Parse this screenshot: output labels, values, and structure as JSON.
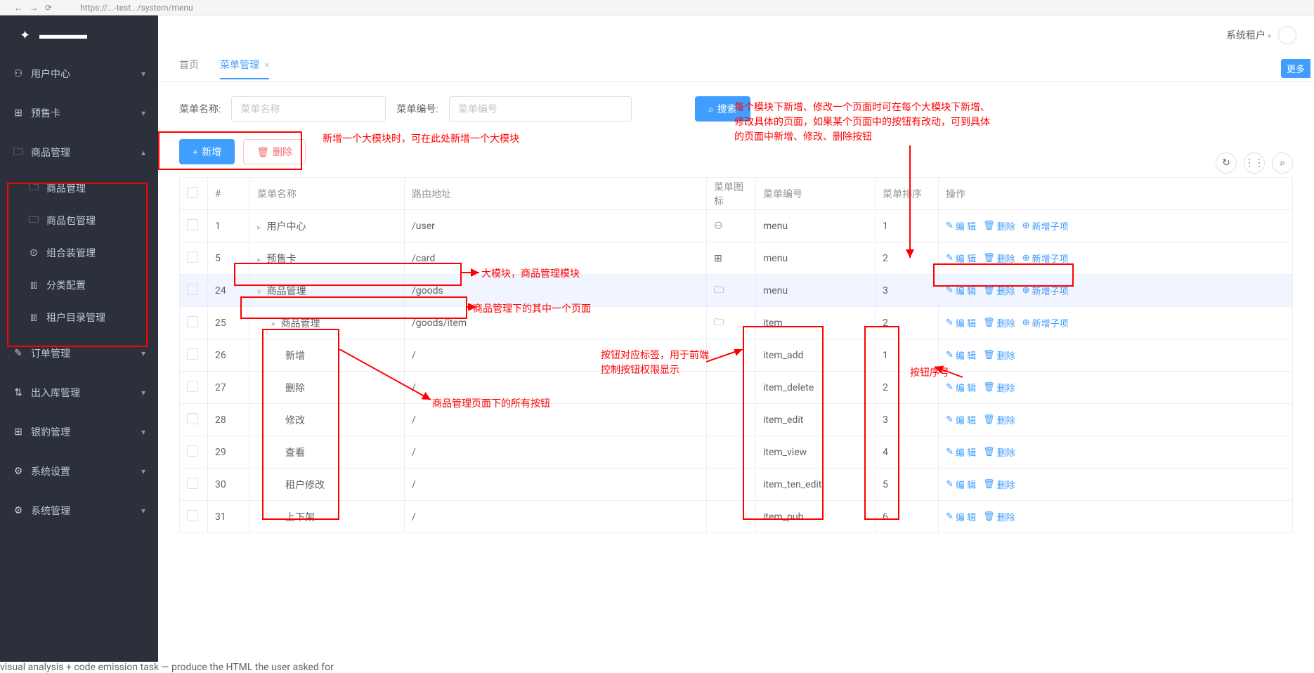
{
  "browser": {
    "url": "https://...-test.../system/menu"
  },
  "header": {
    "tenant": "系统租户"
  },
  "sidebar": {
    "items": [
      {
        "icon": "user-icon",
        "glyph": "⚇",
        "label": "用户中心",
        "chev": "▾"
      },
      {
        "icon": "card-icon",
        "glyph": "⊞",
        "label": "预售卡",
        "chev": "▾"
      },
      {
        "icon": "folder-icon",
        "glyph": "🗀",
        "label": "商品管理",
        "chev": "▴",
        "open": true,
        "children": [
          {
            "icon": "folder-icon",
            "glyph": "🗀",
            "label": "商品管理"
          },
          {
            "icon": "folder-icon",
            "glyph": "🗀",
            "label": "商品包管理"
          },
          {
            "icon": "combo-icon",
            "glyph": "⊙",
            "label": "组合装管理"
          },
          {
            "icon": "chart-icon",
            "glyph": "⫾⫾",
            "label": "分类配置"
          },
          {
            "icon": "chart-icon",
            "glyph": "⫾⫾",
            "label": "租户目录管理"
          }
        ]
      },
      {
        "icon": "order-icon",
        "glyph": "✎",
        "label": "订单管理",
        "chev": "▾"
      },
      {
        "icon": "stock-icon",
        "glyph": "⇅",
        "label": "出入库管理",
        "chev": "▾"
      },
      {
        "icon": "pos-icon",
        "glyph": "⊞",
        "label": "银豹管理",
        "chev": "▾"
      },
      {
        "icon": "gear-icon",
        "glyph": "⚙",
        "label": "系统设置",
        "chev": "▾"
      },
      {
        "icon": "gear-icon",
        "glyph": "⚙",
        "label": "系统管理",
        "chev": "▾"
      }
    ]
  },
  "tabs": {
    "home": "首页",
    "current": "菜单管理",
    "more": "更多"
  },
  "search": {
    "name_label": "菜单名称:",
    "name_ph": "菜单名称",
    "code_label": "菜单编号:",
    "code_ph": "菜单编号",
    "search_btn": "搜索"
  },
  "actions": {
    "add": "新增",
    "del": "删除"
  },
  "columns": {
    "idx": "#",
    "name": "菜单名称",
    "path": "路由地址",
    "icon": "菜单图标",
    "code": "菜单编号",
    "sort": "菜单排序",
    "op": "操作"
  },
  "rowlinks": {
    "edit": "编 辑",
    "del": "删除",
    "addsub": "新增子项"
  },
  "rows": [
    {
      "idx": "1",
      "indent": 0,
      "exp": "▸",
      "name": "用户中心",
      "path": "/user",
      "iconGlyph": "⚇",
      "code": "menu",
      "sort": "1",
      "hasSub": true
    },
    {
      "idx": "5",
      "indent": 0,
      "exp": "▸",
      "name": "预售卡",
      "path": "/card",
      "iconGlyph": "⊞",
      "code": "menu",
      "sort": "2",
      "hasSub": true
    },
    {
      "idx": "24",
      "indent": 0,
      "exp": "▾",
      "name": "商品管理",
      "path": "/goods",
      "iconGlyph": "🗀",
      "code": "menu",
      "sort": "3",
      "hasSub": true,
      "active": true
    },
    {
      "idx": "25",
      "indent": 1,
      "exp": "▾",
      "name": "商品管理",
      "path": "/goods/item",
      "iconGlyph": "🗀",
      "code": "item",
      "sort": "2",
      "hasSub": true
    },
    {
      "idx": "26",
      "indent": 2,
      "exp": "",
      "name": "新增",
      "path": "/",
      "iconGlyph": "",
      "code": "item_add",
      "sort": "1",
      "hasSub": false
    },
    {
      "idx": "27",
      "indent": 2,
      "exp": "",
      "name": "删除",
      "path": "/",
      "iconGlyph": "",
      "code": "item_delete",
      "sort": "2",
      "hasSub": false
    },
    {
      "idx": "28",
      "indent": 2,
      "exp": "",
      "name": "修改",
      "path": "/",
      "iconGlyph": "",
      "code": "item_edit",
      "sort": "3",
      "hasSub": false
    },
    {
      "idx": "29",
      "indent": 2,
      "exp": "",
      "name": "查看",
      "path": "/",
      "iconGlyph": "",
      "code": "item_view",
      "sort": "4",
      "hasSub": false
    },
    {
      "idx": "30",
      "indent": 2,
      "exp": "",
      "name": "租户修改",
      "path": "/",
      "iconGlyph": "",
      "code": "item_ten_edit",
      "sort": "5",
      "hasSub": false
    },
    {
      "idx": "31",
      "indent": 2,
      "exp": "",
      "name": "上下架",
      "path": "/",
      "iconGlyph": "",
      "code": "item_pub",
      "sort": "6",
      "hasSub": false
    }
  ],
  "annotations": {
    "a1": "新增一个大模块时，可在此处新增一个大模块",
    "a2": "每个模块下新增、修改一个页面时可在每个大模块下新增、修改具体的页面，如果某个页面中的按钮有改动，可到具体的页面中新增、修改、删除按钮",
    "a3": "大模块，商品管理模块",
    "a4": "商品管理下的其中一个页面",
    "a5": "商品管理页面下的所有按钮",
    "a6": "按钮对应标签，用于前端控制按钮权限显示",
    "a7": "按钮序号"
  }
}
